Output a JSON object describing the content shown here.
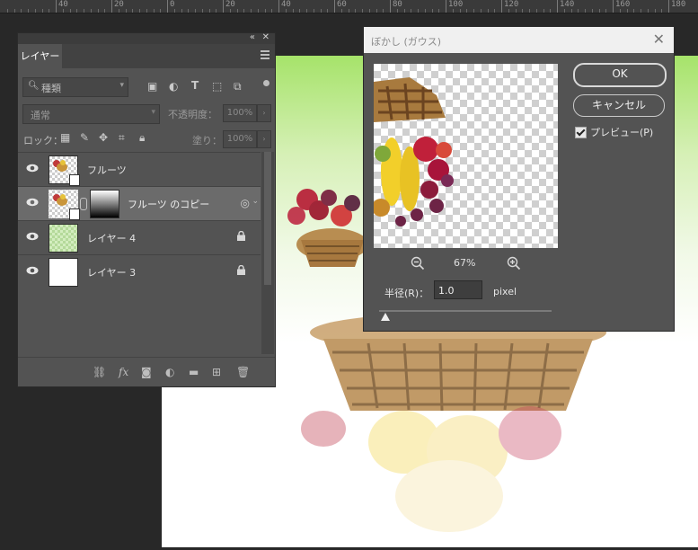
{
  "ruler": {
    "labels": [
      "40",
      "20",
      "0",
      "20",
      "40",
      "60",
      "80",
      "100",
      "120",
      "140",
      "160",
      "180"
    ]
  },
  "layers_panel": {
    "tab_label": "レイヤー",
    "collapse_icon": "double-chevron-left-icon",
    "close_icon": "close-icon",
    "filter": {
      "label": "種類"
    },
    "blend_mode": "通常",
    "opacity_label": "不透明度：",
    "opacity_value": "100%",
    "lock_label": "ロック：",
    "fill_label": "塗り：",
    "fill_value": "100%",
    "layers": [
      {
        "name": "フルーツ",
        "thumb": "smart-object",
        "locked": false,
        "selected": false
      },
      {
        "name": "フルーツ のコピー",
        "thumb": "smart-object-with-mask",
        "locked": false,
        "selected": true
      },
      {
        "name": "レイヤー 4",
        "thumb": "green-transparent",
        "locked": true,
        "selected": false
      },
      {
        "name": "レイヤー 3",
        "thumb": "white",
        "locked": true,
        "selected": false
      }
    ],
    "bottom_tools": [
      "link-icon",
      "fx-icon",
      "mask-icon",
      "adjustment-icon",
      "folder-icon",
      "new-layer-icon",
      "trash-icon"
    ]
  },
  "dialog": {
    "title": "ぼかし (ガウス)",
    "ok_label": "OK",
    "cancel_label": "キャンセル",
    "preview_label": "プレビュー(P)",
    "preview_checked": true,
    "zoom": "67%",
    "radius_label": "半径(R)：",
    "radius_value": "1.0",
    "radius_unit": "pixel",
    "radius_slider_fraction": 0.02
  },
  "colors": {
    "canvas_top": "#a6e36a",
    "panel_bg": "#535353",
    "selected_layer": "#6b6b6b"
  }
}
